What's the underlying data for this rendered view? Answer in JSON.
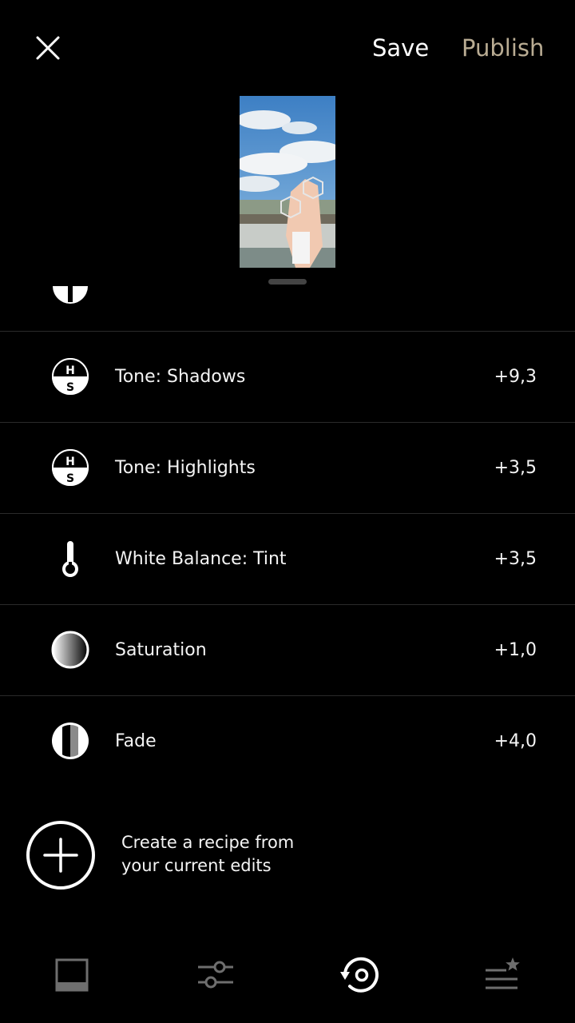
{
  "header": {
    "close_icon": "close-icon",
    "save_label": "Save",
    "publish_label": "Publish",
    "publish_color": "#b9ac93"
  },
  "preview": {
    "thumbnail": "edited-photo-thumbnail"
  },
  "edits": [
    {
      "icon": "tone-hs-icon",
      "label": "Tone: Shadows",
      "value": "+9,3"
    },
    {
      "icon": "tone-hs-icon",
      "label": "Tone: Highlights",
      "value": "+3,5"
    },
    {
      "icon": "thermometer-icon",
      "label": "White Balance: Tint",
      "value": "+3,5"
    },
    {
      "icon": "saturation-icon",
      "label": "Saturation",
      "value": "+1,0"
    },
    {
      "icon": "fade-icon",
      "label": "Fade",
      "value": "+4,0"
    }
  ],
  "recipe": {
    "icon": "plus-circle-icon",
    "line1": "Create a recipe from",
    "line2": "your current edits"
  },
  "toolbar": {
    "items": [
      {
        "icon": "presets-icon",
        "active": false
      },
      {
        "icon": "adjust-sliders-icon",
        "active": false
      },
      {
        "icon": "history-icon",
        "active": true
      },
      {
        "icon": "recipes-icon",
        "active": false
      }
    ],
    "inactive_color": "#6e6e6e",
    "active_color": "#ffffff"
  }
}
